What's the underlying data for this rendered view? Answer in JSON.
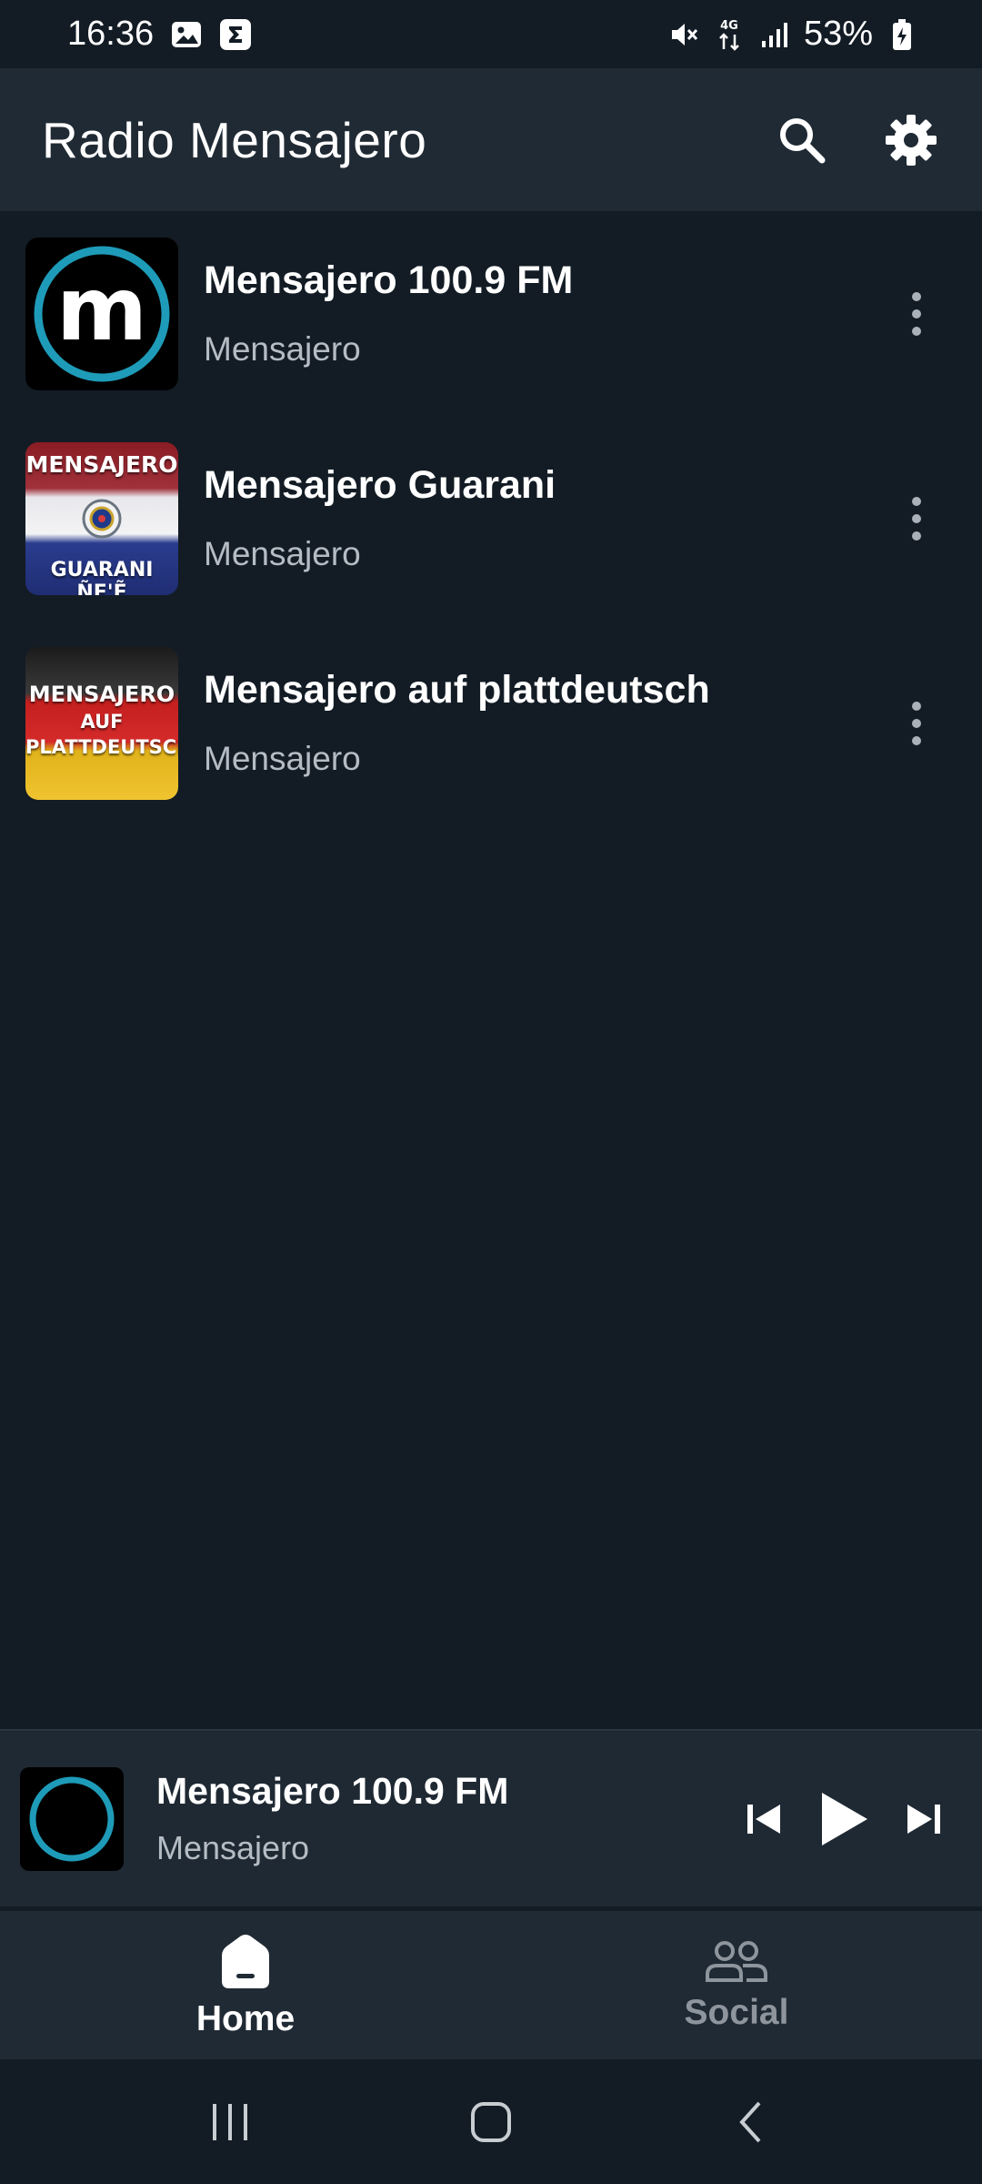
{
  "status_bar": {
    "time": "16:36",
    "network": "4G",
    "battery": "53%"
  },
  "app_bar": {
    "title": "Radio Mensajero"
  },
  "stations": [
    {
      "title": "Mensajero 100.9 FM",
      "subtitle": "Mensajero",
      "logo": "m"
    },
    {
      "title": "Mensajero Guarani",
      "subtitle": "Mensajero",
      "logo_top": "MENSAJERO",
      "logo_bottom": "GUARANI ÑE'Ẽ"
    },
    {
      "title": "Mensajero auf plattdeutsch",
      "subtitle": "Mensajero",
      "logo_line1": "MENSAJERO",
      "logo_line2": "AUF",
      "logo_line3": "PLATTDEUTSCH"
    }
  ],
  "mini_player": {
    "title": "Mensajero 100.9 FM",
    "subtitle": "Mensajero"
  },
  "bottom_nav": {
    "home_label": "Home",
    "social_label": "Social"
  },
  "colors": {
    "background": "#131c25",
    "surface": "#202a34",
    "accent_ring": "#1e9bb8",
    "muted_text": "#b5bcc4"
  }
}
